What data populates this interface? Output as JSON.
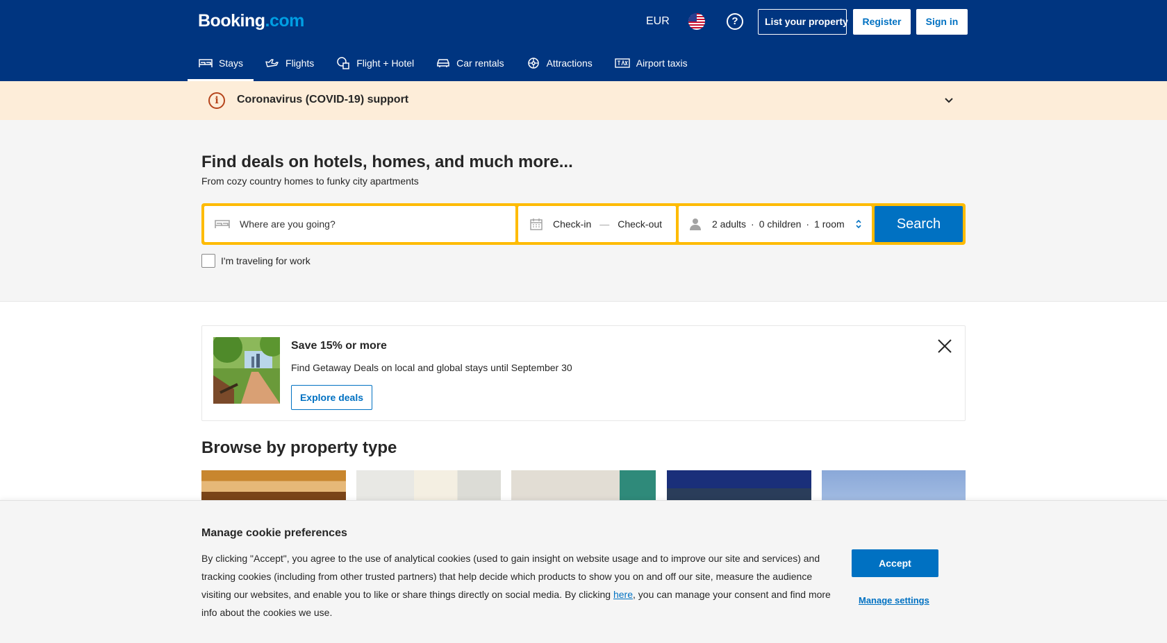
{
  "header": {
    "logo_main": "Booking",
    "logo_dot": ".com",
    "currency": "EUR",
    "help_icon": "?",
    "list_property": "List your property",
    "register": "Register",
    "sign_in": "Sign in"
  },
  "nav": {
    "items": [
      {
        "label": "Stays",
        "icon": "bed-icon"
      },
      {
        "label": "Flights",
        "icon": "plane-icon"
      },
      {
        "label": "Flight + Hotel",
        "icon": "flight-hotel-icon"
      },
      {
        "label": "Car rentals",
        "icon": "car-icon"
      },
      {
        "label": "Attractions",
        "icon": "attractions-icon"
      },
      {
        "label": "Airport taxis",
        "icon": "taxi-icon"
      }
    ]
  },
  "covid": {
    "text": "Coronavirus (COVID-19) support",
    "info_glyph": "i"
  },
  "hero": {
    "title": "Find deals on hotels, homes, and much more...",
    "subtitle": "From cozy country homes to funky city apartments"
  },
  "search": {
    "destination_placeholder": "Where are you going?",
    "checkin": "Check-in",
    "date_sep": "—",
    "checkout": "Check-out",
    "adults": "2 adults",
    "children": "0 children",
    "rooms": "1 room",
    "occ_sep": "·",
    "button": "Search",
    "work_label": "I'm traveling for work"
  },
  "promo": {
    "title": "Save 15% or more",
    "description": "Find Getaway Deals on local and global stays until September 30",
    "button": "Explore deals"
  },
  "browse": {
    "title": "Browse by property type"
  },
  "cookie": {
    "title": "Manage cookie preferences",
    "text_before": "By clicking \"Accept\", you agree to the use of analytical cookies (used to gain insight on website usage and to improve our site and services) and tracking cookies (including from other trusted partners) that help decide which products to show you on and off our site, measure the audience visiting our websites, and enable you to like or share things directly on social media. By clicking ",
    "link": "here",
    "text_after": ", you can manage your consent and find more info about the cookies we use.",
    "accept": "Accept",
    "manage": "Manage settings"
  },
  "colors": {
    "brand": "#003580",
    "accent": "#0071c2",
    "search_border": "#febb02",
    "covid_bg": "#fdedd9"
  }
}
